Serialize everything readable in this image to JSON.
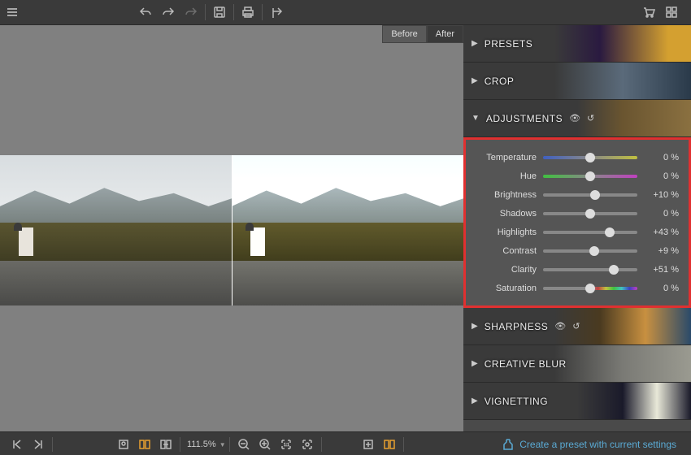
{
  "toolbar": {
    "menu": "≡"
  },
  "tabs": {
    "before": "Before",
    "after": "After"
  },
  "panels": {
    "presets": "PRESETS",
    "crop": "CROP",
    "adjustments": "ADJUSTMENTS",
    "sharpness": "SHARPNESS",
    "creative_blur": "CREATIVE BLUR",
    "vignetting": "VIGNETTING"
  },
  "adjustments": [
    {
      "label": "Temperature",
      "value": "0 %",
      "pos": 50,
      "track": "temp"
    },
    {
      "label": "Hue",
      "value": "0 %",
      "pos": 50,
      "track": "hue"
    },
    {
      "label": "Brightness",
      "value": "+10 %",
      "pos": 55
    },
    {
      "label": "Shadows",
      "value": "0 %",
      "pos": 50
    },
    {
      "label": "Highlights",
      "value": "+43 %",
      "pos": 71
    },
    {
      "label": "Contrast",
      "value": "+9 %",
      "pos": 54
    },
    {
      "label": "Clarity",
      "value": "+51 %",
      "pos": 75
    },
    {
      "label": "Saturation",
      "value": "0 %",
      "pos": 50,
      "track": "sat"
    }
  ],
  "bottombar": {
    "zoom": "111.5%",
    "preset_link": "Create a preset with current settings"
  }
}
